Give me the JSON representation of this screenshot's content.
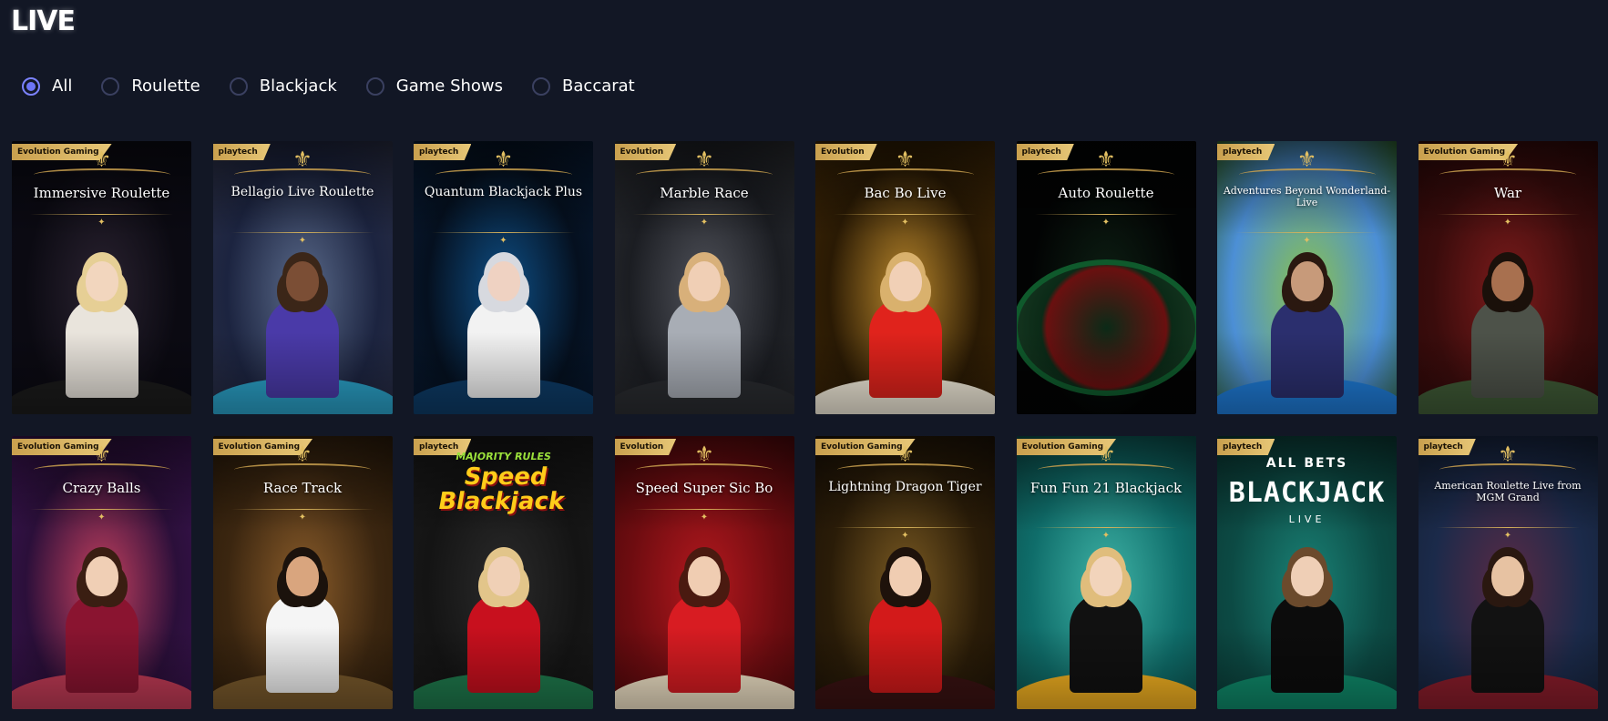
{
  "page": {
    "title": "LIVE"
  },
  "filters": [
    {
      "label": "All",
      "checked": true
    },
    {
      "label": "Roulette",
      "checked": false
    },
    {
      "label": "Blackjack",
      "checked": false
    },
    {
      "label": "Game Shows",
      "checked": false
    },
    {
      "label": "Baccarat",
      "checked": false
    }
  ],
  "games": [
    {
      "title": "Immersive Roulette",
      "provider": "Evolution Gaming",
      "bg": [
        "#0b0a12",
        "#2a2230",
        "#0a0a14"
      ],
      "skin": "#f2d6be",
      "outfit": "#e9e4dc",
      "hair": "#e6cf95",
      "table": "#1b1b1b"
    },
    {
      "title": "Bellagio Live Roulette",
      "provider": "playtech",
      "bg": [
        "#1c2440",
        "#5a6a8a",
        "#2b2f45"
      ],
      "skin": "#7b4e35",
      "outfit": "#4a3aa8",
      "hair": "#3b2618",
      "table": "#2aa0c7"
    },
    {
      "title": "Quantum Blackjack Plus",
      "provider": "playtech",
      "bg": [
        "#05101f",
        "#0e4f86",
        "#071a33"
      ],
      "skin": "#efd2c2",
      "outfit": "#f2f2f2",
      "hair": "#d7d9df",
      "table": "#0d3b66"
    },
    {
      "title": "Marble Race",
      "provider": "Evolution",
      "bg": [
        "#1b1d22",
        "#50525a",
        "#2a2c30"
      ],
      "skin": "#f0cfb5",
      "outfit": "#a8adb5",
      "hair": "#d8b07a",
      "table": "#2a2c30"
    },
    {
      "title": "Bac Bo Live",
      "provider": "Evolution",
      "bg": [
        "#2a1a04",
        "#b8862b",
        "#3d2606"
      ],
      "skin": "#f1d0b6",
      "outfit": "#e0231c",
      "hair": "#d9b16d",
      "table": "#f1ead9"
    },
    {
      "title": "Auto Roulette",
      "provider": "playtech",
      "bg": [
        "#020303",
        "#0d2014",
        "#020303"
      ],
      "skin": "none",
      "outfit": "none",
      "hair": "none",
      "table": "#0f5a2c"
    },
    {
      "title": "Adventures Beyond Wonderland-Live",
      "provider": "playtech",
      "bg": [
        "#4c8fd6",
        "#8bc34a",
        "#2c5d2a"
      ],
      "skin": "#c79a7a",
      "outfit": "#2b2f6e",
      "hair": "#2a1810",
      "table": "#1f7bd6"
    },
    {
      "title": "War",
      "provider": "Evolution Gaming",
      "bg": [
        "#3a0c0c",
        "#7c1b1b",
        "#2b0808"
      ],
      "skin": "#a8704f",
      "outfit": "#4d5249",
      "hair": "#1a100a",
      "table": "#3f5a36"
    },
    {
      "title": "Crazy Balls",
      "provider": "Evolution Gaming",
      "bg": [
        "#2b0f3a",
        "#c4405e",
        "#3b1452"
      ],
      "skin": "#f0cfb5",
      "outfit": "#8a1430",
      "hair": "#3a1e12",
      "table": "#c23b56"
    },
    {
      "title": "Race Track",
      "provider": "Evolution Gaming",
      "bg": [
        "#3b2610",
        "#8a5c2a",
        "#2b1b0a"
      ],
      "skin": "#d9a57e",
      "outfit": "#f5f5f5",
      "hair": "#1b120c",
      "table": "#7a5a2c"
    },
    {
      "title": "Speed Blackjack",
      "provider": "playtech",
      "banner": "MAJORITY RULES",
      "bg": [
        "#141414",
        "#2a2a2a",
        "#1a1a1a"
      ],
      "skin": "#f0d0b6",
      "outfit": "#c8101e",
      "hair": "#e2c58a",
      "table": "#1f7a4d"
    },
    {
      "title": "Speed Super Sic Bo",
      "provider": "Evolution",
      "bg": [
        "#6d0c10",
        "#b3181e",
        "#4a080a"
      ],
      "skin": "#f0cdb2",
      "outfit": "#d81c22",
      "hair": "#4a1a10",
      "table": "#f2e4c8"
    },
    {
      "title": "Lightning Dragon Tiger",
      "provider": "Evolution Gaming",
      "bg": [
        "#2a1c08",
        "#7a5a22",
        "#1c1206"
      ],
      "skin": "#f0cdb2",
      "outfit": "#d31a1a",
      "hair": "#1e120b",
      "table": "#3a1212"
    },
    {
      "title": "Fun Fun 21 Blackjack",
      "provider": "Evolution Gaming",
      "bg": [
        "#0f6d6a",
        "#3fb3a6",
        "#0b4f4c"
      ],
      "skin": "#f2d4bb",
      "outfit": "#111111",
      "hair": "#e0bd7c",
      "table": "#f5b321"
    },
    {
      "title": "BLACKJACK",
      "subtitle": "LIVE",
      "prefix": "ALL BETS",
      "provider": "playtech",
      "bg": [
        "#0c4a44",
        "#1a8276",
        "#0a3a35"
      ],
      "skin": "#efcfb6",
      "outfit": "#0c0c0c",
      "hair": "#6b4a2c",
      "table": "#0f8b6b"
    },
    {
      "title": "American Roulette Live from MGM Grand",
      "provider": "playtech",
      "bg": [
        "#1b2a4a",
        "#5a2a45",
        "#152238"
      ],
      "skin": "#e7c2a2",
      "outfit": "#121212",
      "hair": "#2a1810",
      "table": "#8a1d2b"
    }
  ]
}
